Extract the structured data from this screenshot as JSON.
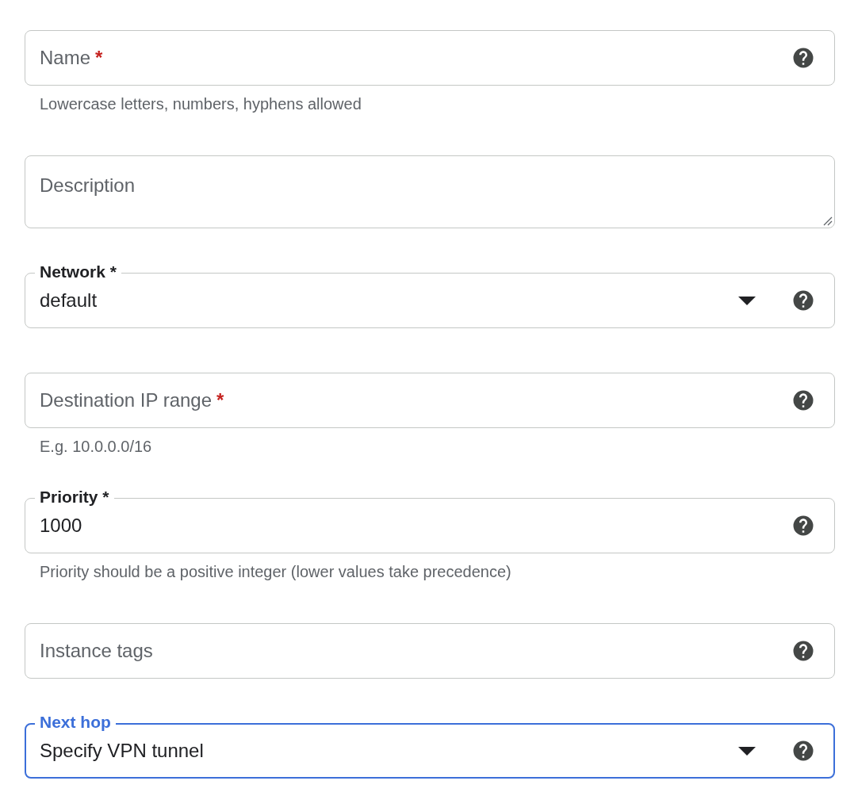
{
  "fields": [
    {
      "kind": "text",
      "label": "Name",
      "required_mark": "*",
      "help_icon": true,
      "helper": "Lowercase letters, numbers, hyphens allowed",
      "focused": false
    },
    {
      "kind": "textarea",
      "label": "Description",
      "focused": false
    },
    {
      "kind": "select",
      "label": "Network",
      "required_mark": "*",
      "value": "default",
      "help_icon": true,
      "focused": false
    },
    {
      "kind": "text",
      "label": "Destination IP range",
      "required_mark": "*",
      "help_icon": true,
      "helper": "E.g. 10.0.0.0/16",
      "focused": false
    },
    {
      "kind": "text",
      "label": "Priority",
      "required_mark": "*",
      "value": "1000",
      "help_icon": true,
      "helper": "Priority should be a positive integer (lower values take precedence)",
      "focused": false
    },
    {
      "kind": "text",
      "label": "Instance tags",
      "help_icon": true,
      "focused": false
    },
    {
      "kind": "select",
      "label": "Next hop",
      "value": "Specify VPN tunnel",
      "help_icon": true,
      "focused": true
    }
  ]
}
